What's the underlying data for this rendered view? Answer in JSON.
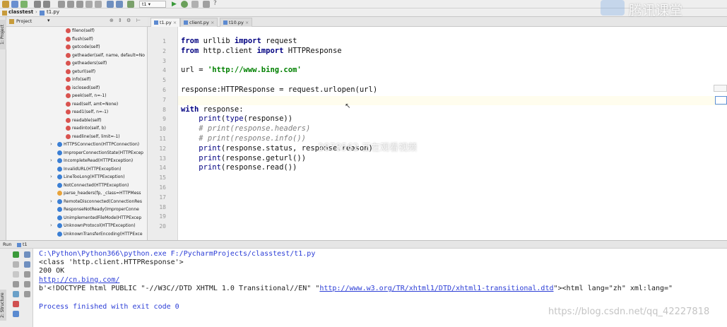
{
  "breadcrumb": {
    "project": "classtest",
    "file": "t1.py"
  },
  "toolbar": {
    "run_config": "t1"
  },
  "left_strip": {
    "project_label": "1: Project",
    "structure_label": "2: Structure"
  },
  "project_panel": {
    "title": "Project"
  },
  "tree": [
    {
      "label": "fileno(self)",
      "icon": "method",
      "expandable": false
    },
    {
      "label": "flush(self)",
      "icon": "method",
      "expandable": false
    },
    {
      "label": "getcode(self)",
      "icon": "method",
      "expandable": false
    },
    {
      "label": "getheader(self, name, default=No",
      "icon": "method",
      "expandable": false
    },
    {
      "label": "getheaders(self)",
      "icon": "method",
      "expandable": false
    },
    {
      "label": "geturl(self)",
      "icon": "method",
      "expandable": false
    },
    {
      "label": "info(self)",
      "icon": "method",
      "expandable": false
    },
    {
      "label": "isclosed(self)",
      "icon": "method",
      "expandable": false
    },
    {
      "label": "peek(self, n=-1)",
      "icon": "method",
      "expandable": false
    },
    {
      "label": "read(self, amt=None)",
      "icon": "method",
      "expandable": false
    },
    {
      "label": "read1(self, n=-1)",
      "icon": "method",
      "expandable": false
    },
    {
      "label": "readable(self)",
      "icon": "method",
      "expandable": false
    },
    {
      "label": "readinto(self, b)",
      "icon": "method",
      "expandable": false
    },
    {
      "label": "readline(self, limit=-1)",
      "icon": "method",
      "expandable": false
    },
    {
      "label": "HTTPSConnection(HTTPConnection)",
      "icon": "class",
      "expandable": true
    },
    {
      "label": "ImproperConnectionState(HTTPExcep",
      "icon": "class",
      "expandable": false
    },
    {
      "label": "IncompleteRead(HTTPException)",
      "icon": "class",
      "expandable": true
    },
    {
      "label": "InvalidURL(HTTPException)",
      "icon": "class",
      "expandable": false
    },
    {
      "label": "LineTooLong(HTTPException)",
      "icon": "class",
      "expandable": true
    },
    {
      "label": "NotConnected(HTTPException)",
      "icon": "class",
      "expandable": false
    },
    {
      "label": "parse_headers(fp, _class=HTTPMess",
      "icon": "function",
      "expandable": false
    },
    {
      "label": "RemoteDisconnected(ConnectionRes",
      "icon": "class",
      "expandable": true
    },
    {
      "label": "ResponseNotReady(ImproperConne",
      "icon": "class",
      "expandable": false
    },
    {
      "label": "UnimplementedFileMode(HTTPExcep",
      "icon": "class",
      "expandable": false
    },
    {
      "label": "UnknownProtocol(HTTPException)",
      "icon": "class",
      "expandable": true
    },
    {
      "label": "UnknownTransferEncoding(HTTPExce",
      "icon": "class",
      "expandable": false
    }
  ],
  "tabs": [
    {
      "label": "t1.py",
      "active": true
    },
    {
      "label": "client.py",
      "active": false
    },
    {
      "label": "t10.py",
      "active": false
    }
  ],
  "editor": {
    "line_numbers": [
      "1",
      "2",
      "3",
      "4",
      "5",
      "6",
      "7",
      "8",
      "9",
      "10",
      "11",
      "12",
      "13",
      "14",
      "15",
      "16",
      "17",
      "18",
      "19",
      "20"
    ],
    "lines": [
      {
        "n": 1,
        "parts": [
          {
            "t": "from",
            "c": "kw"
          },
          {
            "t": " urllib ",
            "c": ""
          },
          {
            "t": "import",
            "c": "kw"
          },
          {
            "t": " request",
            "c": ""
          }
        ]
      },
      {
        "n": 2,
        "parts": [
          {
            "t": "from",
            "c": "kw"
          },
          {
            "t": " http.client ",
            "c": ""
          },
          {
            "t": "import",
            "c": "kw"
          },
          {
            "t": " HTTPResponse",
            "c": ""
          }
        ]
      },
      {
        "n": 4,
        "parts": [
          {
            "t": "url = ",
            "c": ""
          },
          {
            "t": "'http://www.bing.com'",
            "c": "str"
          }
        ]
      },
      {
        "n": 6,
        "parts": [
          {
            "t": "response:HTTPResponse = request.urlopen(url)",
            "c": ""
          }
        ]
      },
      {
        "n": 8,
        "parts": [
          {
            "t": "with",
            "c": "kw"
          },
          {
            "t": " response:",
            "c": ""
          }
        ]
      },
      {
        "n": 9,
        "parts": [
          {
            "t": "    ",
            "c": ""
          },
          {
            "t": "print",
            "c": "bi"
          },
          {
            "t": "(",
            "c": ""
          },
          {
            "t": "type",
            "c": "bi"
          },
          {
            "t": "(response))",
            "c": ""
          }
        ]
      },
      {
        "n": 10,
        "parts": [
          {
            "t": "    # print(response.headers)",
            "c": "cm"
          }
        ]
      },
      {
        "n": 11,
        "parts": [
          {
            "t": "    # print(response.info())",
            "c": "cm"
          }
        ]
      },
      {
        "n": 12,
        "parts": [
          {
            "t": "    ",
            "c": ""
          },
          {
            "t": "print",
            "c": "bi"
          },
          {
            "t": "(response.status, response.reason)",
            "c": ""
          }
        ]
      },
      {
        "n": 13,
        "parts": [
          {
            "t": "    ",
            "c": ""
          },
          {
            "t": "print",
            "c": "bi"
          },
          {
            "t": "(response.geturl())",
            "c": ""
          }
        ]
      },
      {
        "n": 14,
        "parts": [
          {
            "t": "    ",
            "c": ""
          },
          {
            "t": "print",
            "c": "bi"
          },
          {
            "t": "(response.read())",
            "c": ""
          }
        ]
      }
    ]
  },
  "run_panel": {
    "title": "Run",
    "config": "t1"
  },
  "console": {
    "cmd": "C:\\Python\\Python366\\python.exe F:/PycharmProjects/classtest/t1.py",
    "line2": "<class 'http.client.HTTPResponse'>",
    "line3": "200 OK",
    "line4_link": "http://cn.bing.com/",
    "line5_pre": "b'<!DOCTYPE html PUBLIC \"-//W3C//DTD XHTML 1.0 Transitional//EN\" \"",
    "line5_link": "http://www.w3.org/TR/xhtml1/DTD/xhtml1-transitional.dtd",
    "line5_post": "\"><html lang=\"zh\" xml:lang=\"",
    "line6": "Process finished with exit code 0"
  },
  "watermark": {
    "brand": "腾讯课堂",
    "overlay": "2878562 正在观看视频",
    "csdn": "https://blog.csdn.net/qq_42227818"
  },
  "colors": {
    "keyword": "#000080",
    "string": "#008000",
    "comment": "#808080",
    "link": "#2a3cd6",
    "method_icon": "#d9534f",
    "class_icon": "#3b7fd4",
    "function_icon": "#e8a33a"
  }
}
